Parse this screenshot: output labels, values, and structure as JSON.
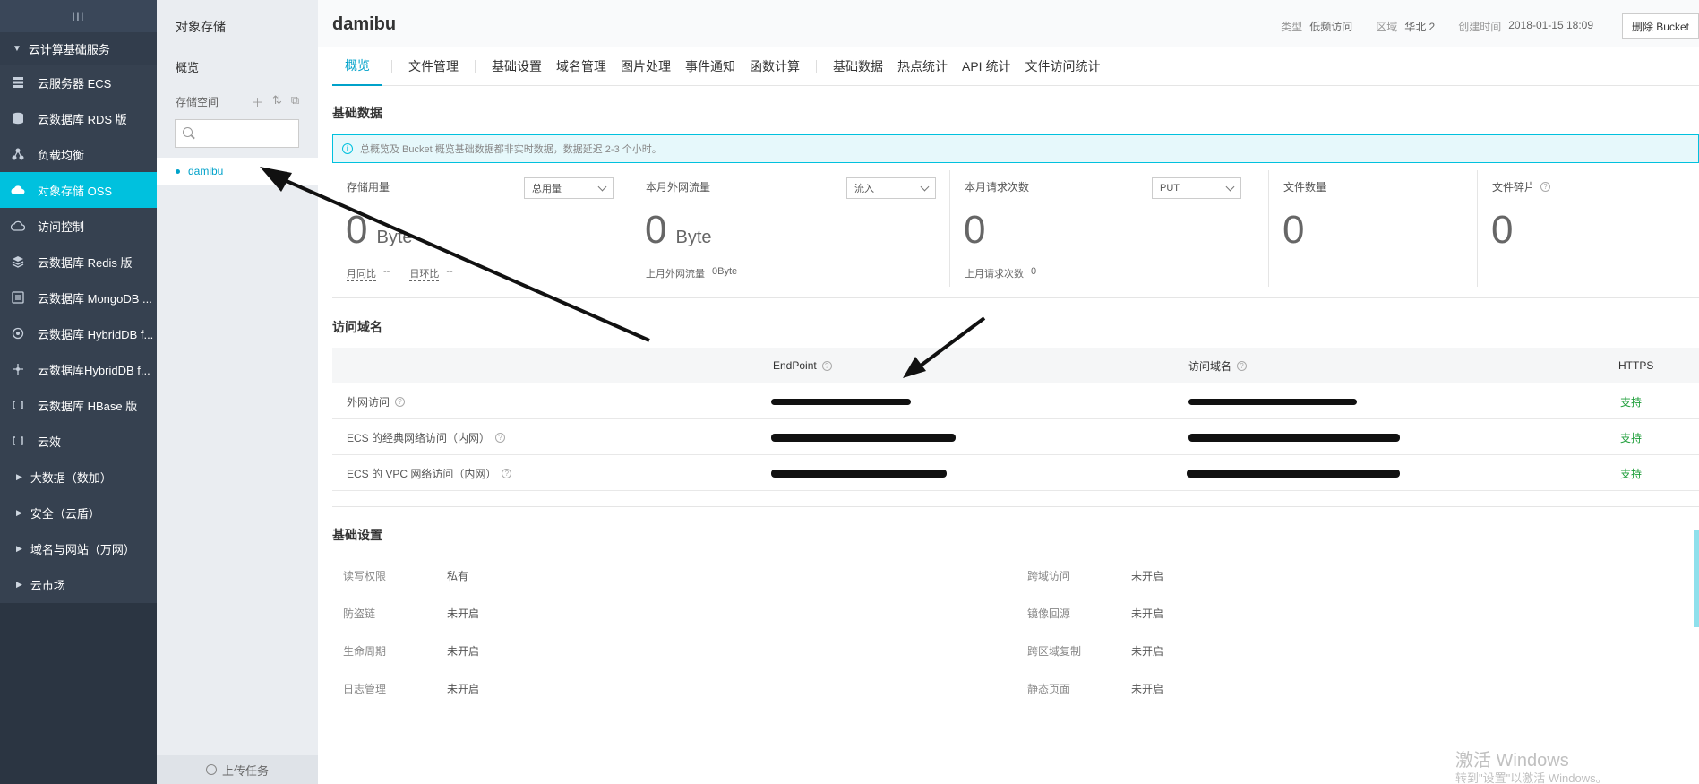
{
  "sidebar": {
    "toggle": "III",
    "group_title": "云计算基础服务",
    "items": [
      {
        "label": "云服务器 ECS",
        "icon": "server-icon"
      },
      {
        "label": "云数据库 RDS 版",
        "icon": "database-icon"
      },
      {
        "label": "负载均衡",
        "icon": "load-balancer-icon"
      },
      {
        "label": "对象存储 OSS",
        "icon": "cloud-storage-icon",
        "active": true
      },
      {
        "label": "访问控制",
        "icon": "access-control-icon"
      },
      {
        "label": "云数据库 Redis 版",
        "icon": "redis-icon"
      },
      {
        "label": "云数据库 MongoDB ...",
        "icon": "mongodb-icon"
      },
      {
        "label": "云数据库 HybridDB f...",
        "icon": "hybriddb-icon"
      },
      {
        "label": "云数据库HybridDB f...",
        "icon": "hybriddb-cluster-icon"
      },
      {
        "label": "云数据库 HBase 版",
        "icon": "hbase-icon"
      },
      {
        "label": "云效",
        "icon": "devops-icon"
      }
    ],
    "subgroups": [
      "大数据（数加）",
      "安全（云盾）",
      "域名与网站（万网）",
      "云市场"
    ]
  },
  "panel2": {
    "title": "对象存储",
    "overview": "概览",
    "space_label": "存储空间",
    "search_placeholder": "",
    "bucket": "damibu",
    "upload": "上传任务"
  },
  "header": {
    "bucket_name": "damibu",
    "type_key": "类型",
    "type_val": "低频访问",
    "region_key": "区域",
    "region_val": "华北 2",
    "created_key": "创建时间",
    "created_val": "2018-01-15 18:09",
    "delete_btn": "删除 Bucket"
  },
  "tabs": [
    {
      "label": "概览",
      "active": true
    },
    {
      "label": "文件管理"
    },
    {
      "label": "基础设置"
    },
    {
      "label": "域名管理"
    },
    {
      "label": "图片处理"
    },
    {
      "label": "事件通知"
    },
    {
      "label": "函数计算"
    },
    {
      "label": "基础数据"
    },
    {
      "label": "热点统计"
    },
    {
      "label": "API 统计"
    },
    {
      "label": "文件访问统计"
    }
  ],
  "basic_data": {
    "title": "基础数据",
    "notice": "总概览及 Bucket 概览基础数据都非实时数据，数据延迟 2-3 个小时。",
    "stats": [
      {
        "label": "存储用量",
        "dropdown": "总用量",
        "value": "0",
        "unit": "Byte",
        "sub_a": "月同比",
        "sub_a_val": "--",
        "sub_b": "日环比",
        "sub_b_val": "--"
      },
      {
        "label": "本月外网流量",
        "dropdown": "流入",
        "value": "0",
        "unit": "Byte",
        "sub": "上月外网流量",
        "sub_val": "0Byte"
      },
      {
        "label": "本月请求次数",
        "dropdown": "PUT",
        "value": "0",
        "sub": "上月请求次数",
        "sub_val": "0"
      },
      {
        "label": "文件数量",
        "value": "0"
      },
      {
        "label": "文件碎片",
        "value": "0"
      }
    ]
  },
  "domains": {
    "title": "访问域名",
    "col_endpoint": "EndPoint",
    "col_domain": "访问域名",
    "col_https": "HTTPS",
    "rows": [
      {
        "name": "外网访问",
        "https": "支持"
      },
      {
        "name": "ECS 的经典网络访问（内网）",
        "https": "支持"
      },
      {
        "name": "ECS 的 VPC 网络访问（内网）",
        "https": "支持"
      }
    ]
  },
  "settings": {
    "title": "基础设置",
    "left": [
      {
        "k": "读写权限",
        "v": "私有"
      },
      {
        "k": "防盗链",
        "v": "未开启"
      },
      {
        "k": "生命周期",
        "v": "未开启"
      },
      {
        "k": "日志管理",
        "v": "未开启"
      }
    ],
    "right": [
      {
        "k": "跨域访问",
        "v": "未开启"
      },
      {
        "k": "镜像回源",
        "v": "未开启"
      },
      {
        "k": "跨区域复制",
        "v": "未开启"
      },
      {
        "k": "静态页面",
        "v": "未开启"
      }
    ]
  },
  "watermark": {
    "line1": "激活 Windows",
    "line2": "转到\"设置\"以激活 Windows。"
  }
}
